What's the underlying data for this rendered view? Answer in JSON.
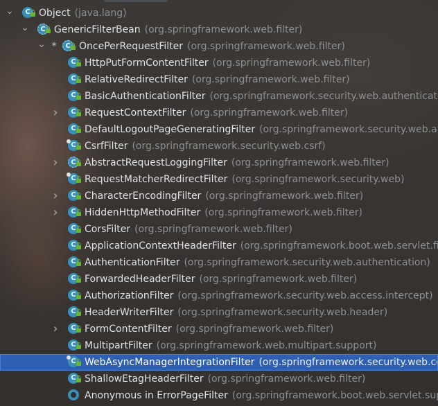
{
  "colors": {
    "selection": "#2f5fb3",
    "class_icon": "#3a8fb7",
    "access_lock": "#67b33b",
    "package_text": "#8c8f94",
    "class_text": "#dfe1e5"
  },
  "tree": {
    "rows": [
      {
        "level": 0,
        "expander": "expanded",
        "icon": "class-icon",
        "name": "Object",
        "package": "(java.lang)"
      },
      {
        "level": 1,
        "expander": "expanded",
        "icon": "abstract-class-icon",
        "name": "GenericFilterBean",
        "package": "(org.springframework.web.filter)"
      },
      {
        "level": 2,
        "expander": "expanded",
        "marker": "*",
        "icon": "abstract-class-icon",
        "name": "OncePerRequestFilter",
        "package": "(org.springframework.web.filter)"
      },
      {
        "level": 3,
        "expander": "none",
        "icon": "class-icon",
        "name": "HttpPutFormContentFilter",
        "package": "(org.springframework.web.filter)"
      },
      {
        "level": 3,
        "expander": "none",
        "icon": "class-icon",
        "name": "RelativeRedirectFilter",
        "package": "(org.springframework.web.filter)"
      },
      {
        "level": 3,
        "expander": "none",
        "icon": "class-icon",
        "name": "BasicAuthenticationFilter",
        "package": "(org.springframework.security.web.authenticatio"
      },
      {
        "level": 3,
        "expander": "collapsed",
        "icon": "class-icon",
        "name": "RequestContextFilter",
        "package": "(org.springframework.web.filter)"
      },
      {
        "level": 3,
        "expander": "none",
        "icon": "class-icon",
        "name": "DefaultLogoutPageGeneratingFilter",
        "package": "(org.springframework.security.web.au"
      },
      {
        "level": 3,
        "expander": "none",
        "icon": "class-icon",
        "pinned": true,
        "name": "CsrfFilter",
        "package": "(org.springframework.security.web.csrf)"
      },
      {
        "level": 3,
        "expander": "collapsed",
        "icon": "abstract-class-icon",
        "name": "AbstractRequestLoggingFilter",
        "package": "(org.springframework.web.filter)"
      },
      {
        "level": 3,
        "expander": "none",
        "icon": "class-icon",
        "pinned": true,
        "name": "RequestMatcherRedirectFilter",
        "package": "(org.springframework.security.web)"
      },
      {
        "level": 3,
        "expander": "collapsed",
        "icon": "class-icon",
        "name": "CharacterEncodingFilter",
        "package": "(org.springframework.web.filter)"
      },
      {
        "level": 3,
        "expander": "collapsed",
        "icon": "class-icon",
        "name": "HiddenHttpMethodFilter",
        "package": "(org.springframework.web.filter)"
      },
      {
        "level": 3,
        "expander": "none",
        "icon": "class-icon",
        "name": "CorsFilter",
        "package": "(org.springframework.web.filter)"
      },
      {
        "level": 3,
        "expander": "none",
        "icon": "class-icon",
        "name": "ApplicationContextHeaderFilter",
        "package": "(org.springframework.boot.web.servlet.filt"
      },
      {
        "level": 3,
        "expander": "none",
        "icon": "class-icon",
        "name": "AuthenticationFilter",
        "package": "(org.springframework.security.web.authentication)"
      },
      {
        "level": 3,
        "expander": "none",
        "icon": "class-icon",
        "name": "ForwardedHeaderFilter",
        "package": "(org.springframework.web.filter)"
      },
      {
        "level": 3,
        "expander": "none",
        "icon": "class-icon",
        "name": "AuthorizationFilter",
        "package": "(org.springframework.security.web.access.intercept)"
      },
      {
        "level": 3,
        "expander": "none",
        "icon": "class-icon",
        "name": "HeaderWriterFilter",
        "package": "(org.springframework.security.web.header)"
      },
      {
        "level": 3,
        "expander": "collapsed",
        "icon": "class-icon",
        "name": "FormContentFilter",
        "package": "(org.springframework.web.filter)"
      },
      {
        "level": 3,
        "expander": "none",
        "icon": "class-icon",
        "name": "MultipartFilter",
        "package": "(org.springframework.web.multipart.support)"
      },
      {
        "level": 3,
        "expander": "none",
        "icon": "class-icon",
        "pinned": true,
        "selected": true,
        "name": "WebAsyncManagerIntegrationFilter",
        "package": "(org.springframework.security.web.cor"
      },
      {
        "level": 3,
        "expander": "none",
        "icon": "class-icon",
        "name": "ShallowEtagHeaderFilter",
        "package": "(org.springframework.web.filter)"
      },
      {
        "level": 3,
        "expander": "none",
        "icon": "anonymous-class-icon",
        "name": "Anonymous in ErrorPageFilter",
        "package": "(org.springframework.boot.web.servlet.sup"
      }
    ]
  }
}
